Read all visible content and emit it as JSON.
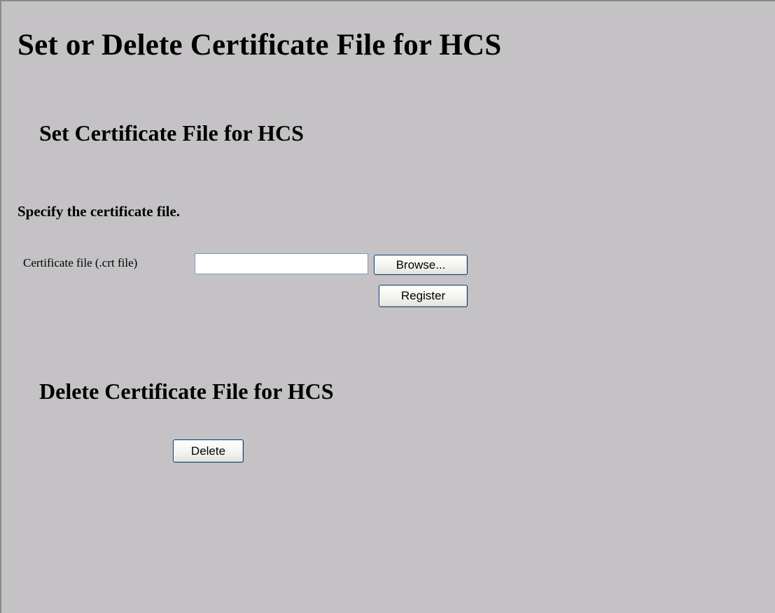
{
  "page": {
    "title": "Set or Delete Certificate File for HCS",
    "background_color": "#c4c2c5"
  },
  "set_section": {
    "title": "Set Certificate File for HCS",
    "instruction": "Specify the certificate file.",
    "certificate_field": {
      "label": "Certificate file (.crt file)",
      "value": "",
      "placeholder": ""
    },
    "browse_label": "Browse...",
    "register_label": "Register"
  },
  "delete_section": {
    "title": "Delete Certificate File for HCS",
    "delete_label": "Delete"
  }
}
